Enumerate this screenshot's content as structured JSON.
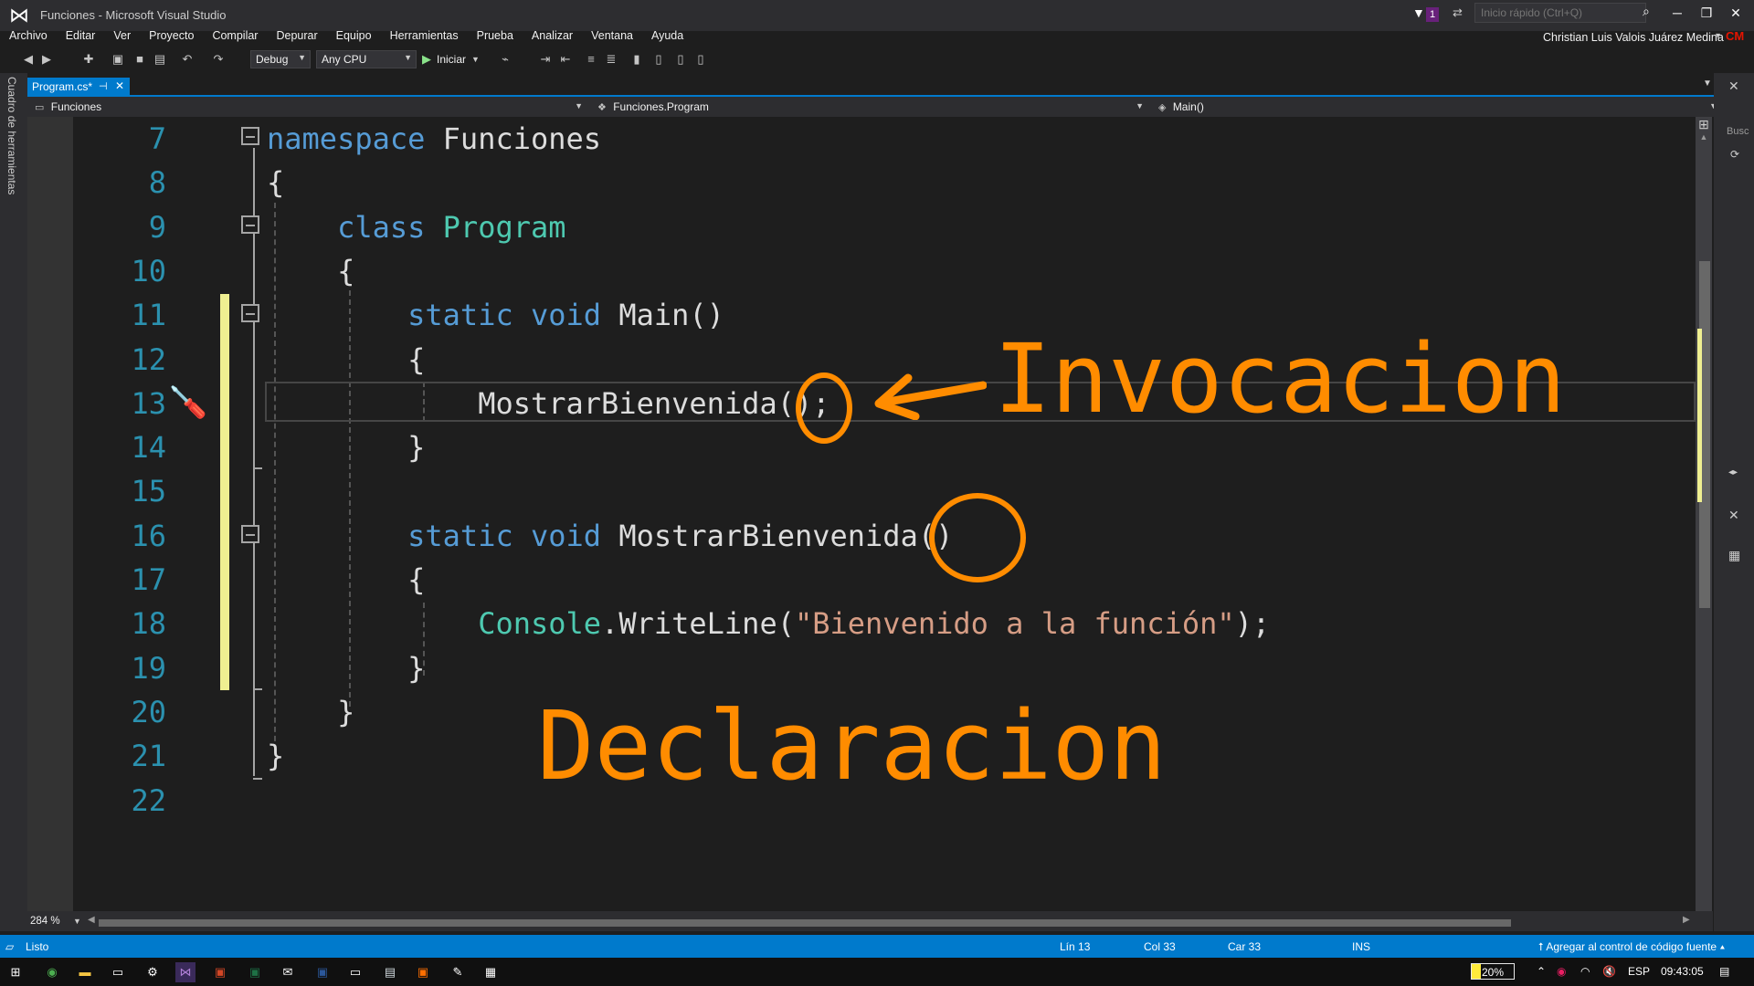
{
  "window": {
    "title": "Funciones - Microsoft Visual Studio",
    "notification_count": "1",
    "quick_launch_placeholder": "Inicio rápido (Ctrl+Q)",
    "user_name": "Christian Luis Valois Juárez Medina",
    "user_initials": "CM"
  },
  "menu": [
    "Archivo",
    "Editar",
    "Ver",
    "Proyecto",
    "Compilar",
    "Depurar",
    "Equipo",
    "Herramientas",
    "Prueba",
    "Analizar",
    "Ventana",
    "Ayuda"
  ],
  "toolbar": {
    "configuration": "Debug",
    "platform": "Any CPU",
    "start_label": "Iniciar"
  },
  "toolbox_label": "Cuadro de herramientas",
  "tab": {
    "label": "Program.cs*"
  },
  "navbar": {
    "project": "Funciones",
    "class": "Funciones.Program",
    "member": "Main()"
  },
  "right_panel": {
    "search_label": "Busc"
  },
  "code": {
    "line_numbers": [
      "7",
      "8",
      "9",
      "10",
      "11",
      "12",
      "13",
      "14",
      "15",
      "16",
      "17",
      "18",
      "19",
      "20",
      "21",
      "22"
    ],
    "lines": [
      [
        {
          "t": "namespace",
          "c": "kw"
        },
        {
          "t": " Funciones",
          "c": "plain"
        }
      ],
      [
        {
          "t": "{",
          "c": "plain"
        }
      ],
      [
        {
          "t": "    ",
          "c": "plain"
        },
        {
          "t": "class",
          "c": "kw"
        },
        {
          "t": " ",
          "c": "plain"
        },
        {
          "t": "Program",
          "c": "type"
        }
      ],
      [
        {
          "t": "    {",
          "c": "plain"
        }
      ],
      [
        {
          "t": "        ",
          "c": "plain"
        },
        {
          "t": "static",
          "c": "kw"
        },
        {
          "t": " ",
          "c": "plain"
        },
        {
          "t": "void",
          "c": "kw"
        },
        {
          "t": " Main()",
          "c": "plain"
        }
      ],
      [
        {
          "t": "        {",
          "c": "plain"
        }
      ],
      [
        {
          "t": "            MostrarBienvenida();",
          "c": "plain"
        }
      ],
      [
        {
          "t": "        }",
          "c": "plain"
        }
      ],
      [
        {
          "t": "",
          "c": "plain"
        }
      ],
      [
        {
          "t": "        ",
          "c": "plain"
        },
        {
          "t": "static",
          "c": "kw"
        },
        {
          "t": " ",
          "c": "plain"
        },
        {
          "t": "void",
          "c": "kw"
        },
        {
          "t": " MostrarBienvenida()",
          "c": "plain"
        }
      ],
      [
        {
          "t": "        {",
          "c": "plain"
        }
      ],
      [
        {
          "t": "            ",
          "c": "plain"
        },
        {
          "t": "Console",
          "c": "type"
        },
        {
          "t": ".WriteLine(",
          "c": "plain"
        },
        {
          "t": "\"Bienvenido a la función\"",
          "c": "str"
        },
        {
          "t": ");",
          "c": "plain"
        }
      ],
      [
        {
          "t": "        }",
          "c": "plain"
        }
      ],
      [
        {
          "t": "    }",
          "c": "plain"
        }
      ],
      [
        {
          "t": "}",
          "c": "plain"
        }
      ],
      [
        {
          "t": "",
          "c": "plain"
        }
      ]
    ]
  },
  "annotations": {
    "invocation": "Invocacion",
    "declaration": "Declaracion"
  },
  "editor": {
    "zoom": "284 %"
  },
  "status": {
    "ready": "Listo",
    "line": "Lín 13",
    "col": "Col 33",
    "char": "Car 33",
    "mode": "INS",
    "source_control": "Agregar al control de código fuente"
  },
  "taskbar": {
    "battery": "20%",
    "language": "ESP",
    "time": "09:43:05"
  },
  "colors": {
    "accent": "#007acc",
    "keyword": "#569cd6",
    "type": "#4ec9b0",
    "string": "#d69d85",
    "line_number": "#2b91af",
    "annotation": "#ff8c00",
    "changed_line": "#efef91"
  }
}
